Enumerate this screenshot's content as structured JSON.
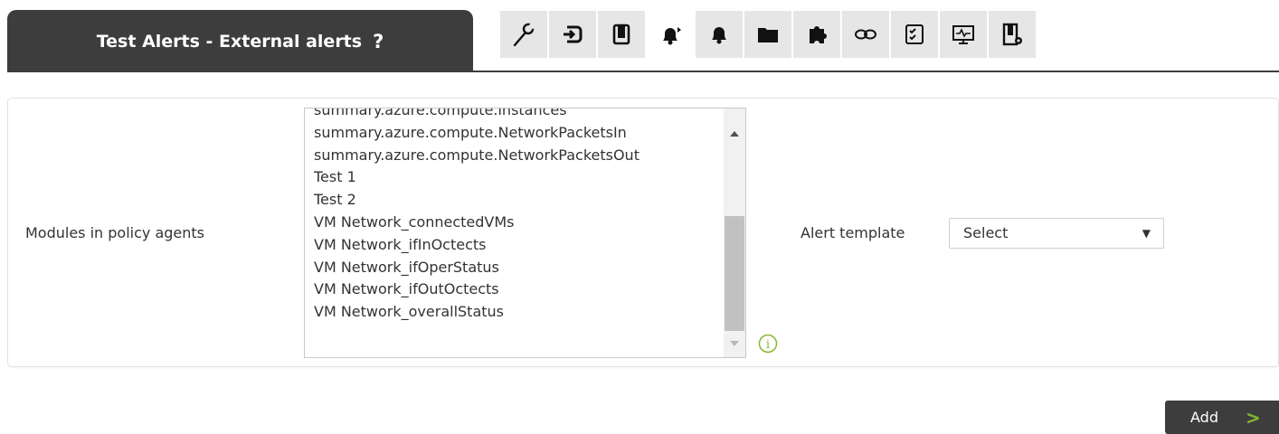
{
  "header": {
    "title": "Test Alerts - External alerts",
    "help_glyph": "?"
  },
  "toolbar": {
    "buttons": [
      {
        "icon": "wrench-icon"
      },
      {
        "icon": "login-icon"
      },
      {
        "icon": "copy-icon"
      },
      {
        "icon": "external-alerts-icon",
        "active": true
      },
      {
        "icon": "bell-icon"
      },
      {
        "icon": "folder-icon"
      },
      {
        "icon": "plugin-icon"
      },
      {
        "icon": "link-icon"
      },
      {
        "icon": "checklist-icon"
      },
      {
        "icon": "monitor-icon"
      },
      {
        "icon": "settings-icon"
      }
    ]
  },
  "form": {
    "modules_label": "Modules in policy agents",
    "modules_options": [
      "summary.azure.compute.instances",
      "summary.azure.compute.NetworkPacketsIn",
      "summary.azure.compute.NetworkPacketsOut",
      "Test 1",
      "Test 2",
      "VM Network_connectedVMs",
      "VM Network_ifInOctects",
      "VM Network_ifOperStatus",
      "VM Network_ifOutOctects",
      "VM Network_overallStatus"
    ],
    "alert_template_label": "Alert template",
    "alert_template_value": "Select",
    "info_glyph": "i"
  },
  "actions": {
    "add_label": "Add",
    "add_glyph": ">"
  },
  "colors": {
    "header_bg": "#3d3d3d",
    "accent_green": "#82b92e",
    "toolbar_bg": "#e6e6e6"
  }
}
